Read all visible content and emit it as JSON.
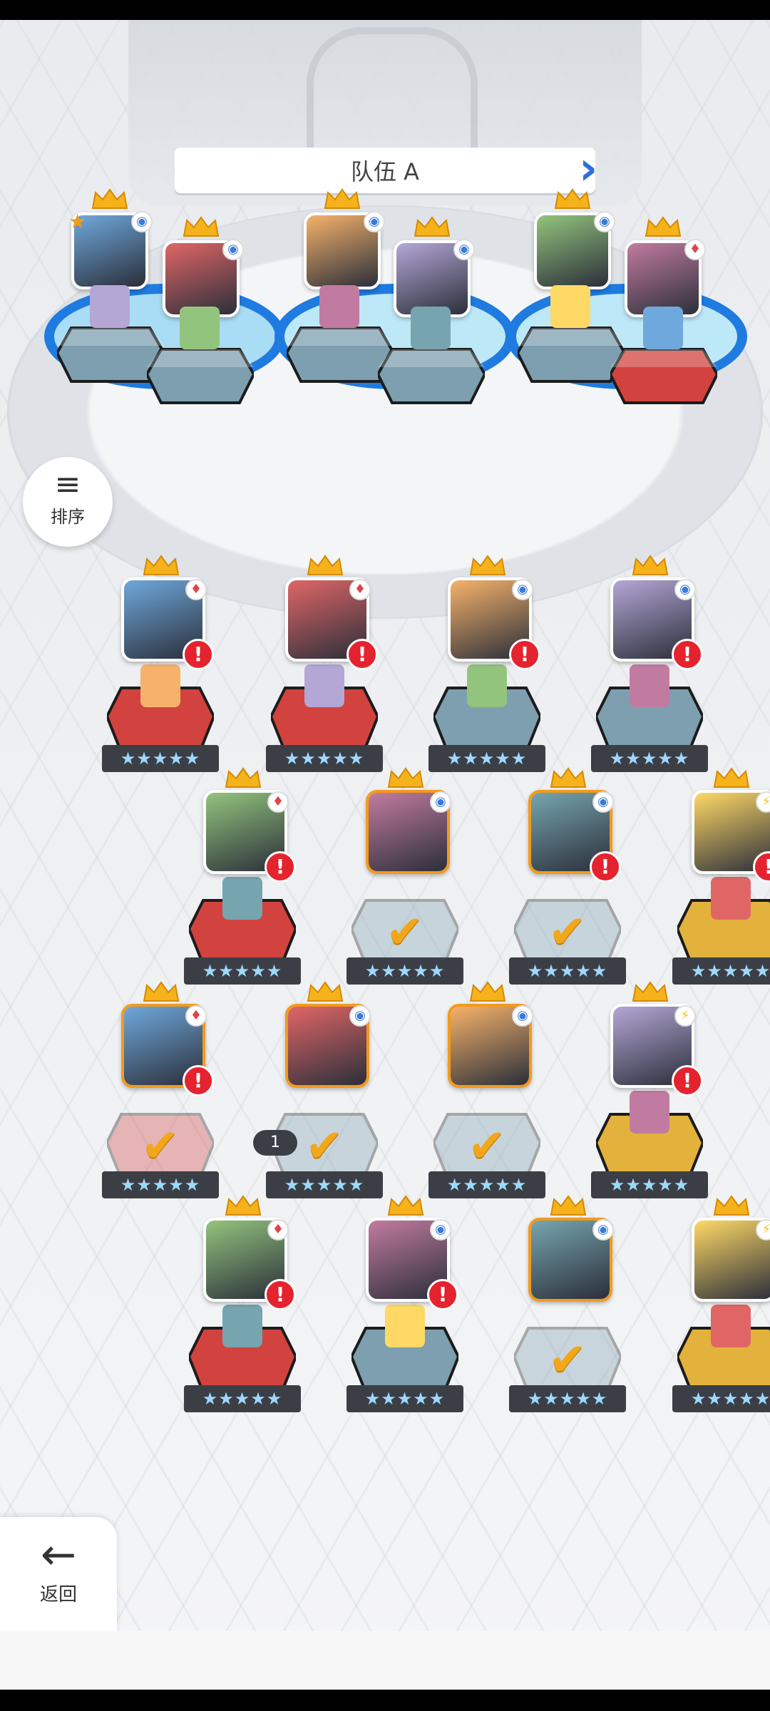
{
  "team": {
    "title": "队伍 A"
  },
  "controls": {
    "sort_label": "排序",
    "sort_icon": "sort-icon",
    "back_label": "返回",
    "back_icon": "arrow-left-icon",
    "stack_badge": "1"
  },
  "elements": {
    "water": "◉",
    "fire": "♦",
    "light": "⚡",
    "star": "★"
  },
  "colors": {
    "water": "#3a7bd5",
    "fire": "#e0434b",
    "light": "#f0c320",
    "selected": "#f39a1b",
    "pedestal_blue": "#7d9fb0",
    "pedestal_red": "#d2433f",
    "pedestal_gold": "#e3b23c",
    "warning": "#e4232f"
  },
  "team_slots": [
    {
      "element": "water",
      "star": true
    },
    {
      "element": "water"
    },
    {
      "element": "water"
    },
    {
      "element": "water"
    },
    {
      "element": "water"
    },
    {
      "element": "fire"
    }
  ],
  "roster_stars": "★★★★★",
  "roster": [
    {
      "element": "fire",
      "warn": true,
      "selected": false
    },
    {
      "element": "fire",
      "warn": true,
      "selected": false
    },
    {
      "element": "water",
      "warn": true,
      "selected": false
    },
    {
      "element": "water",
      "warn": true,
      "selected": false
    },
    {
      "element": "fire",
      "warn": true,
      "selected": false
    },
    {
      "element": "water",
      "warn": false,
      "selected": true
    },
    {
      "element": "water",
      "warn": true,
      "selected": true
    },
    {
      "element": "light",
      "warn": true,
      "selected": false
    },
    {
      "element": "fire",
      "warn": true,
      "selected": true
    },
    {
      "element": "water",
      "warn": false,
      "selected": true
    },
    {
      "element": "water",
      "warn": false,
      "selected": true
    },
    {
      "element": "light",
      "warn": true,
      "selected": false
    },
    {
      "element": "fire",
      "warn": true,
      "selected": false
    },
    {
      "element": "water",
      "warn": true,
      "selected": false
    },
    {
      "element": "water",
      "warn": false,
      "selected": true
    },
    {
      "element": "light",
      "warn": false,
      "selected": false
    }
  ]
}
